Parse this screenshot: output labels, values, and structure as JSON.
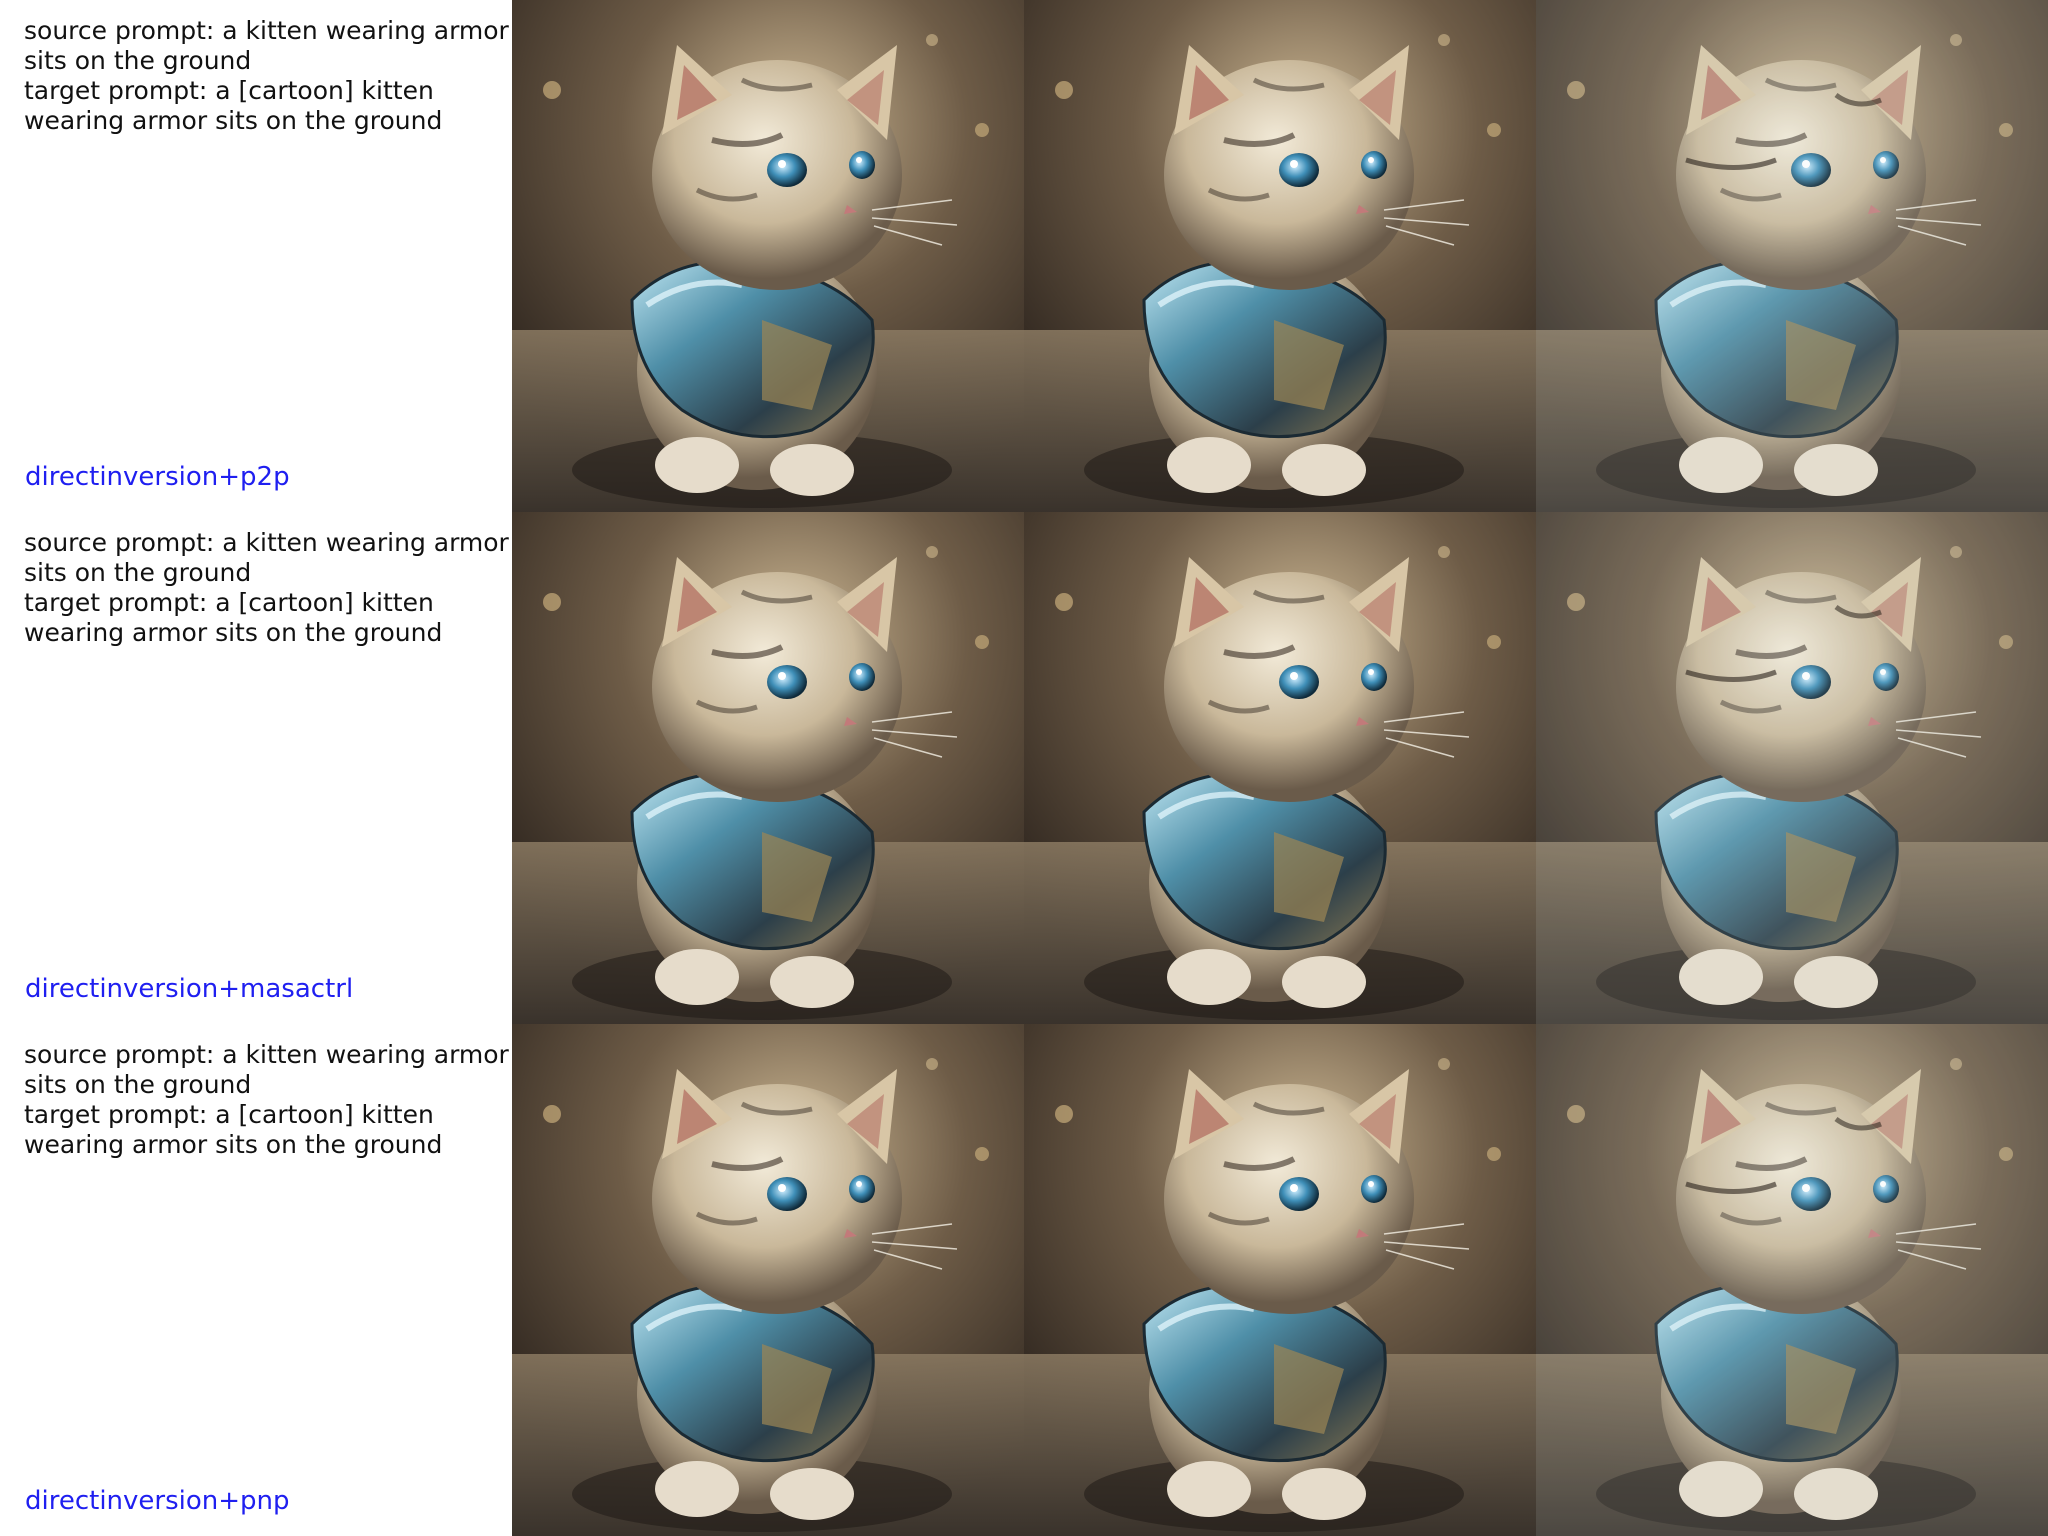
{
  "rows": [
    {
      "source_prompt": "source prompt: a kitten wearing armor sits on the ground",
      "target_prompt": "target prompt: a [cartoon] kitten wearing armor sits on the ground",
      "method_label": "directinversion+p2p",
      "images": [
        "kitten-armor-photo",
        "kitten-armor-photo",
        "kitten-armor-photo-edited"
      ]
    },
    {
      "source_prompt": "source prompt: a kitten wearing armor sits on the ground",
      "target_prompt": "target prompt: a [cartoon] kitten wearing armor sits on the ground",
      "method_label": "directinversion+masactrl",
      "images": [
        "kitten-armor-photo",
        "kitten-armor-photo",
        "kitten-armor-photo-edited"
      ]
    },
    {
      "source_prompt": "source prompt: a kitten wearing armor sits on the ground",
      "target_prompt": "target prompt: a [cartoon] kitten wearing armor sits on the ground",
      "method_label": "directinversion+pnp",
      "images": [
        "kitten-armor-photo",
        "kitten-armor-photo",
        "kitten-armor-photo-edited"
      ]
    }
  ],
  "colors": {
    "method_label": "#1f1ff0",
    "prompt_text": "#111111",
    "background": "#ffffff"
  }
}
